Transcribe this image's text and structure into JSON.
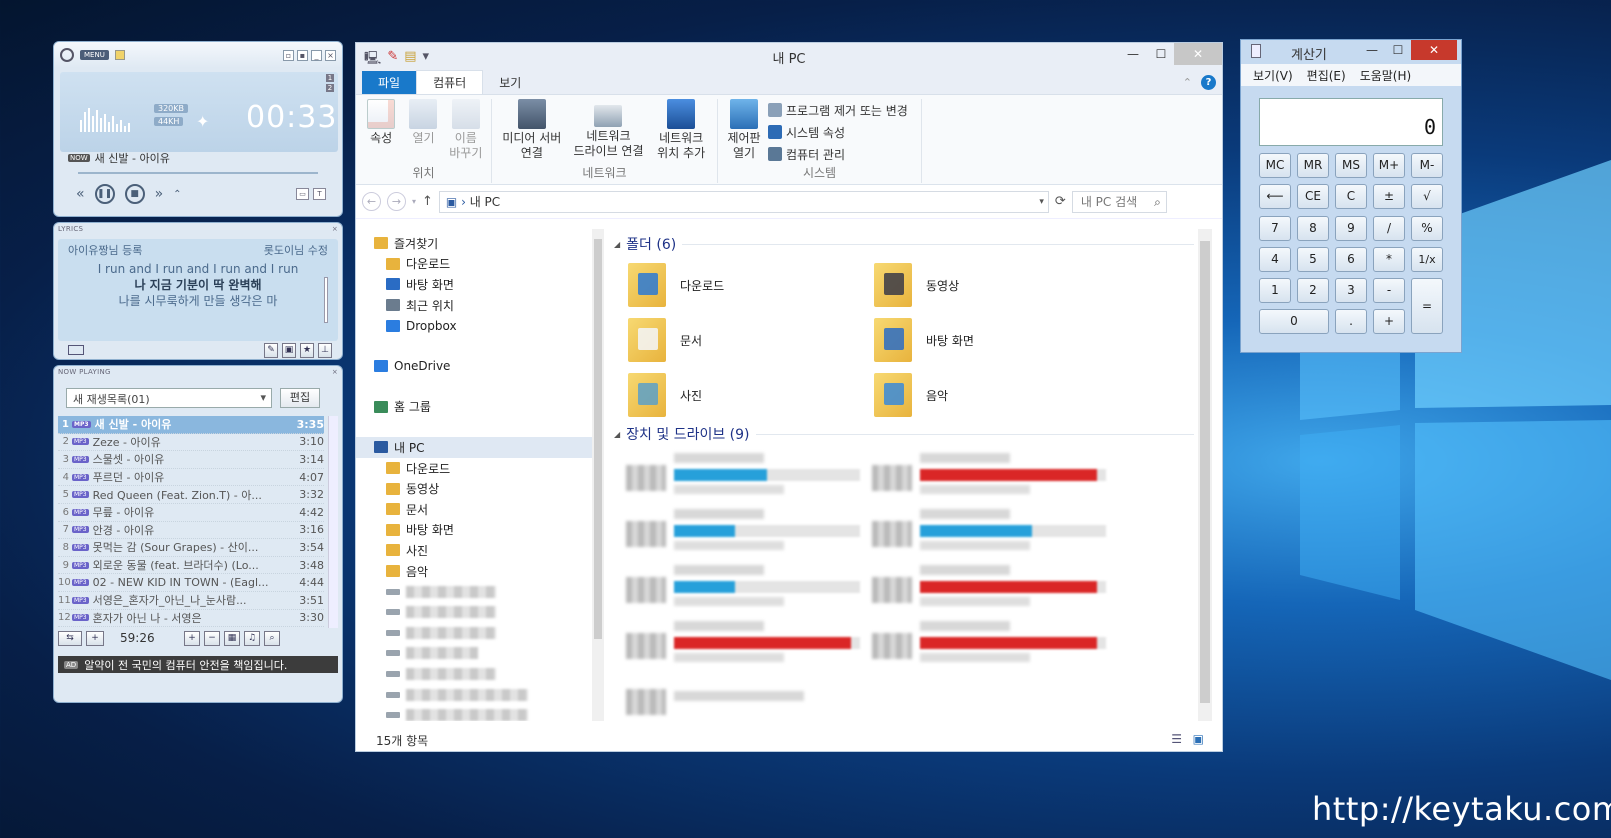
{
  "player": {
    "menu_label": "MENU",
    "bitrate": "320KB",
    "freq": "44KH",
    "time": "00:33",
    "side_nums": [
      "1",
      "2"
    ],
    "now_song": "새 신발 - 아이유",
    "lyrics_header": "LYRICS",
    "lyrics_author_left": "아이유짱님 등록",
    "lyrics_author_right": "롯도이님 수정",
    "lyrics": [
      "I run and I run and I run and I run",
      "나 지금 기분이 딱 완벽해",
      "나를 시무룩하게 만들 생각은 마"
    ],
    "np_header": "NOW PLAYING",
    "playlist_name": "새 재생목록(01)",
    "edit_label": "편집",
    "tracks": [
      {
        "n": "1",
        "title": "새 신발 - 아이유",
        "dur": "3:35"
      },
      {
        "n": "2",
        "title": "Zeze - 아이유",
        "dur": "3:10"
      },
      {
        "n": "3",
        "title": "스물셋 - 아이유",
        "dur": "3:14"
      },
      {
        "n": "4",
        "title": "푸르던 - 아이유",
        "dur": "4:07"
      },
      {
        "n": "5",
        "title": "Red Queen (Feat. Zion.T) - 아...",
        "dur": "3:32"
      },
      {
        "n": "6",
        "title": "무릎 - 아이유",
        "dur": "4:42"
      },
      {
        "n": "7",
        "title": "안경 - 아이유",
        "dur": "3:16"
      },
      {
        "n": "8",
        "title": "못먹는 감 (Sour Grapes) - 산이...",
        "dur": "3:54"
      },
      {
        "n": "9",
        "title": "외로운 동물 (feat. 브라더수) (Lo...",
        "dur": "3:48"
      },
      {
        "n": "10",
        "title": "02 - NEW KID IN TOWN - (Eagl...",
        "dur": "4:44"
      },
      {
        "n": "11",
        "title": "서영은_혼자가_아닌_나_눈사람...",
        "dur": "3:51"
      },
      {
        "n": "12",
        "title": "혼자가 아닌 나 - 서영은",
        "dur": "3:30"
      }
    ],
    "total_time": "59:26",
    "ad_tag": "AD",
    "ad_text": "알약이 전 국민의 컴퓨터 안전을 책임집니다."
  },
  "explorer": {
    "title": "내 PC",
    "tabs": [
      "파일",
      "컴퓨터",
      "보기"
    ],
    "ribbon": {
      "location_group": "위치",
      "properties": "속성",
      "open": "열기",
      "rename_1": "이름",
      "rename_2": "바꾸기",
      "network_group": "네트워크",
      "media_1": "미디어 서버",
      "media_2": "연결",
      "netdrive_1": "네트워크",
      "netdrive_2": "드라이브 연결",
      "netloc_1": "네트워크",
      "netloc_2": "위치 추가",
      "system_group": "시스템",
      "cpanel_1": "제어판",
      "cpanel_2": "열기",
      "uninstall": "프로그램 제거 또는 변경",
      "sysprops": "시스템 속성",
      "compmgmt": "컴퓨터 관리"
    },
    "address": "내 PC",
    "search_placeholder": "내 PC 검색",
    "nav": {
      "favorites": "즐겨찾기",
      "fav_items": [
        "다운로드",
        "바탕 화면",
        "최근 위치",
        "Dropbox"
      ],
      "onedrive": "OneDrive",
      "homegroup": "홈 그룹",
      "thispc": "내 PC",
      "pc_items": [
        "다운로드",
        "동영상",
        "문서",
        "바탕 화면",
        "사진",
        "음악"
      ]
    },
    "folders_header": "폴더 (6)",
    "folders": [
      "다운로드",
      "동영상",
      "문서",
      "바탕 화면",
      "사진",
      "음악"
    ],
    "drives_header": "장치 및 드라이브 (9)",
    "drives": [
      {
        "fill": 0.5,
        "color": "#26a0da"
      },
      {
        "fill": 0.95,
        "color": "#da2626"
      },
      {
        "fill": 0.33,
        "color": "#26a0da"
      },
      {
        "fill": 0.6,
        "color": "#26a0da"
      },
      {
        "fill": 0.33,
        "color": "#26a0da"
      },
      {
        "fill": 0.95,
        "color": "#da2626"
      },
      {
        "fill": 0.95,
        "color": "#da2626"
      },
      {
        "fill": 0.95,
        "color": "#da2626"
      }
    ],
    "status": "15개 항목"
  },
  "calculator": {
    "title": "계산기",
    "menu": [
      "보기(V)",
      "편집(E)",
      "도움말(H)"
    ],
    "display": "0",
    "buttons": [
      "MC",
      "MR",
      "MS",
      "M+",
      "M-",
      "⟵",
      "CE",
      "C",
      "±",
      "√",
      "7",
      "8",
      "9",
      "/",
      "%",
      "4",
      "5",
      "6",
      "*",
      "1/x",
      "1",
      "2",
      "3",
      "-",
      "=",
      "0",
      ".",
      "+"
    ]
  },
  "watermark": "http://keytaku.com"
}
